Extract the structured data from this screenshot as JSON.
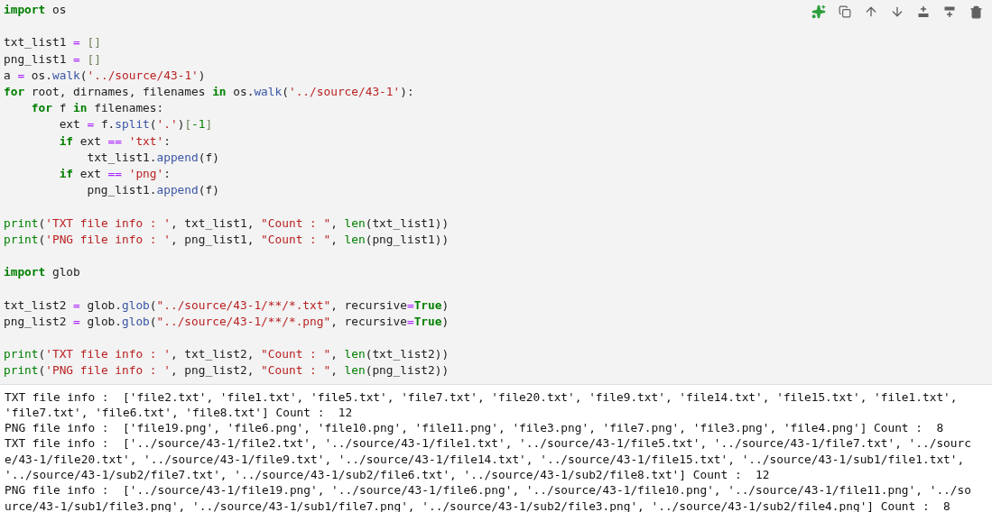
{
  "code_blocks": [
    [
      [
        {
          "kind": "kw",
          "text": "import"
        },
        {
          "kind": "name",
          "text": " os"
        }
      ]
    ],
    [
      [
        {
          "kind": "name",
          "text": "txt_list1 "
        },
        {
          "kind": "op",
          "text": "="
        },
        {
          "kind": "bracket",
          "text": " []"
        }
      ],
      [
        {
          "kind": "name",
          "text": "png_list1 "
        },
        {
          "kind": "op",
          "text": "="
        },
        {
          "kind": "bracket",
          "text": " []"
        }
      ],
      [
        {
          "kind": "name",
          "text": "a "
        },
        {
          "kind": "op",
          "text": "="
        },
        {
          "kind": "name",
          "text": " os."
        },
        {
          "kind": "attr",
          "text": "walk"
        },
        {
          "kind": "punct",
          "text": "("
        },
        {
          "kind": "str",
          "text": "'../source/43-1'"
        },
        {
          "kind": "punct",
          "text": ")"
        }
      ],
      [
        {
          "kind": "kw",
          "text": "for"
        },
        {
          "kind": "name",
          "text": " root, dirnames, filenames "
        },
        {
          "kind": "kw",
          "text": "in"
        },
        {
          "kind": "name",
          "text": " os."
        },
        {
          "kind": "attr",
          "text": "walk"
        },
        {
          "kind": "punct",
          "text": "("
        },
        {
          "kind": "str",
          "text": "'../source/43-1'"
        },
        {
          "kind": "punct",
          "text": "):"
        }
      ],
      [
        {
          "kind": "kw",
          "text": "    for"
        },
        {
          "kind": "name",
          "text": " f "
        },
        {
          "kind": "kw",
          "text": "in"
        },
        {
          "kind": "name",
          "text": " filenames:"
        }
      ],
      [
        {
          "kind": "name",
          "text": "        ext "
        },
        {
          "kind": "op",
          "text": "="
        },
        {
          "kind": "name",
          "text": " f."
        },
        {
          "kind": "attr",
          "text": "split"
        },
        {
          "kind": "punct",
          "text": "("
        },
        {
          "kind": "str",
          "text": "'.'"
        },
        {
          "kind": "punct",
          "text": ")"
        },
        {
          "kind": "bracket",
          "text": "["
        },
        {
          "kind": "num",
          "text": "-1"
        },
        {
          "kind": "bracket",
          "text": "]"
        }
      ],
      [
        {
          "kind": "kw",
          "text": "        if"
        },
        {
          "kind": "name",
          "text": " ext "
        },
        {
          "kind": "op",
          "text": "=="
        },
        {
          "kind": "str",
          "text": " 'txt'"
        },
        {
          "kind": "punct",
          "text": ":"
        }
      ],
      [
        {
          "kind": "name",
          "text": "            txt_list1."
        },
        {
          "kind": "attr",
          "text": "append"
        },
        {
          "kind": "punct",
          "text": "(f)"
        }
      ],
      [
        {
          "kind": "kw",
          "text": "        if"
        },
        {
          "kind": "name",
          "text": " ext "
        },
        {
          "kind": "op",
          "text": "=="
        },
        {
          "kind": "str",
          "text": " 'png'"
        },
        {
          "kind": "punct",
          "text": ":"
        }
      ],
      [
        {
          "kind": "name",
          "text": "            png_list1."
        },
        {
          "kind": "attr",
          "text": "append"
        },
        {
          "kind": "punct",
          "text": "(f)"
        }
      ]
    ],
    [
      [
        {
          "kind": "builtin",
          "text": "print"
        },
        {
          "kind": "punct",
          "text": "("
        },
        {
          "kind": "str",
          "text": "'TXT file info : '"
        },
        {
          "kind": "punct",
          "text": ", txt_list1, "
        },
        {
          "kind": "str",
          "text": "\"Count : \""
        },
        {
          "kind": "punct",
          "text": ", "
        },
        {
          "kind": "builtin",
          "text": "len"
        },
        {
          "kind": "punct",
          "text": "(txt_list1))"
        }
      ],
      [
        {
          "kind": "builtin",
          "text": "print"
        },
        {
          "kind": "punct",
          "text": "("
        },
        {
          "kind": "str",
          "text": "'PNG file info : '"
        },
        {
          "kind": "punct",
          "text": ", png_list1, "
        },
        {
          "kind": "str",
          "text": "\"Count : \""
        },
        {
          "kind": "punct",
          "text": ", "
        },
        {
          "kind": "builtin",
          "text": "len"
        },
        {
          "kind": "punct",
          "text": "(png_list1))"
        }
      ]
    ],
    [
      [
        {
          "kind": "kw",
          "text": "import"
        },
        {
          "kind": "name",
          "text": " glob"
        }
      ]
    ],
    [
      [
        {
          "kind": "name",
          "text": "txt_list2 "
        },
        {
          "kind": "op",
          "text": "="
        },
        {
          "kind": "name",
          "text": " glob."
        },
        {
          "kind": "attr",
          "text": "glob"
        },
        {
          "kind": "punct",
          "text": "("
        },
        {
          "kind": "str",
          "text": "\"../source/43-1/**/*.txt\""
        },
        {
          "kind": "punct",
          "text": ", recursive"
        },
        {
          "kind": "op",
          "text": "="
        },
        {
          "kind": "kw",
          "text": "True"
        },
        {
          "kind": "punct",
          "text": ")"
        }
      ],
      [
        {
          "kind": "name",
          "text": "png_list2 "
        },
        {
          "kind": "op",
          "text": "="
        },
        {
          "kind": "name",
          "text": " glob."
        },
        {
          "kind": "attr",
          "text": "glob"
        },
        {
          "kind": "punct",
          "text": "("
        },
        {
          "kind": "str",
          "text": "\"../source/43-1/**/*.png\""
        },
        {
          "kind": "punct",
          "text": ", recursive"
        },
        {
          "kind": "op",
          "text": "="
        },
        {
          "kind": "kw",
          "text": "True"
        },
        {
          "kind": "punct",
          "text": ")"
        }
      ]
    ],
    [
      [
        {
          "kind": "builtin",
          "text": "print"
        },
        {
          "kind": "punct",
          "text": "("
        },
        {
          "kind": "str",
          "text": "'TXT file info : '"
        },
        {
          "kind": "punct",
          "text": ", txt_list2, "
        },
        {
          "kind": "str",
          "text": "\"Count : \""
        },
        {
          "kind": "punct",
          "text": ", "
        },
        {
          "kind": "builtin",
          "text": "len"
        },
        {
          "kind": "punct",
          "text": "(txt_list2))"
        }
      ],
      [
        {
          "kind": "builtin",
          "text": "print"
        },
        {
          "kind": "punct",
          "text": "("
        },
        {
          "kind": "str",
          "text": "'PNG file info : '"
        },
        {
          "kind": "punct",
          "text": ", png_list2, "
        },
        {
          "kind": "str",
          "text": "\"Count : \""
        },
        {
          "kind": "punct",
          "text": ", "
        },
        {
          "kind": "builtin",
          "text": "len"
        },
        {
          "kind": "punct",
          "text": "(png_list2))"
        }
      ]
    ]
  ],
  "output_lines": [
    "TXT file info :  ['file2.txt', 'file1.txt', 'file5.txt', 'file7.txt', 'file20.txt', 'file9.txt', 'file14.txt', 'file15.txt', 'file1.txt',",
    "'file7.txt', 'file6.txt', 'file8.txt'] Count :  12",
    "PNG file info :  ['file19.png', 'file6.png', 'file10.png', 'file11.png', 'file3.png', 'file7.png', 'file3.png', 'file4.png'] Count :  8",
    "TXT file info :  ['../source/43-1/file2.txt', '../source/43-1/file1.txt', '../source/43-1/file5.txt', '../source/43-1/file7.txt', '../sourc",
    "e/43-1/file20.txt', '../source/43-1/file9.txt', '../source/43-1/file14.txt', '../source/43-1/file15.txt', '../source/43-1/sub1/file1.txt',",
    "'../source/43-1/sub2/file7.txt', '../source/43-1/sub2/file6.txt', '../source/43-1/sub2/file8.txt'] Count :  12",
    "PNG file info :  ['../source/43-1/file19.png', '../source/43-1/file6.png', '../source/43-1/file10.png', '../source/43-1/file11.png', '../so",
    "urce/43-1/sub1/file3.png', '../source/43-1/sub1/file7.png', '../source/43-1/sub2/file3.png', '../source/43-1/sub2/file4.png'] Count :  8"
  ]
}
